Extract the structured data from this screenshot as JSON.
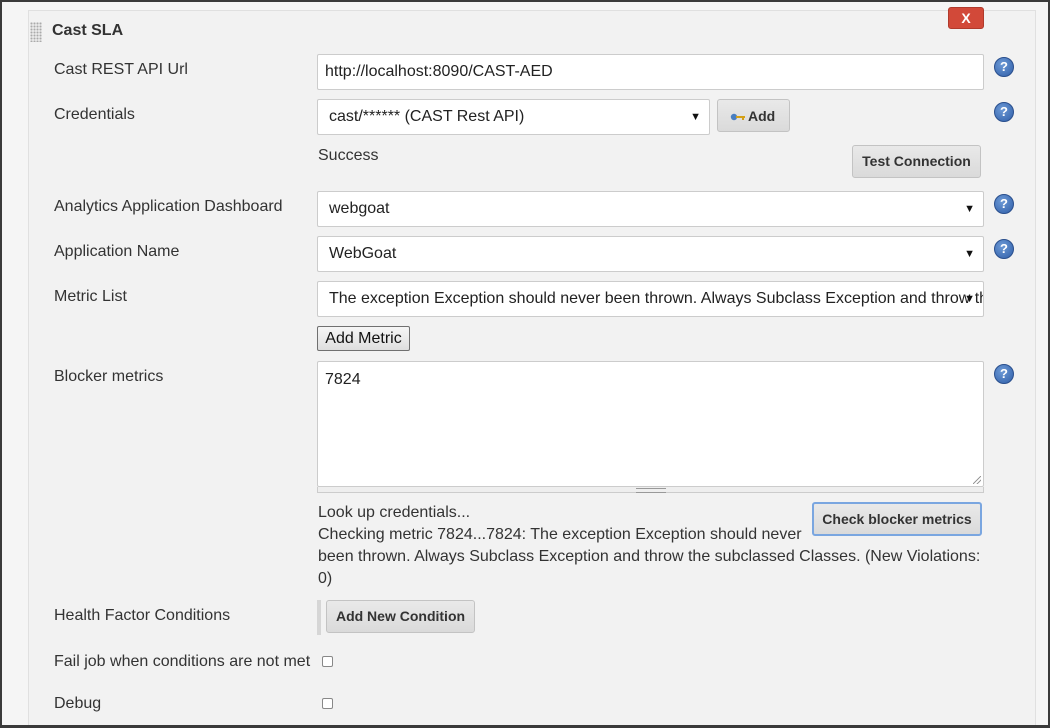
{
  "section": {
    "title": "Cast SLA",
    "delete_label": "X"
  },
  "help_glyph": "?",
  "fields": {
    "rest_api_url": {
      "label": "Cast REST API Url",
      "value": "http://localhost:8090/CAST-AED"
    },
    "credentials": {
      "label": "Credentials",
      "selected": "cast/****** (CAST Rest API)",
      "add_label": "Add",
      "status": "Success",
      "test_connection_label": "Test Connection"
    },
    "dashboard": {
      "label": "Analytics Application Dashboard",
      "selected": "webgoat"
    },
    "application_name": {
      "label": "Application Name",
      "selected": "WebGoat"
    },
    "metric_list": {
      "label": "Metric List",
      "selected": "The exception Exception should never been thrown. Always Subclass Exception and throw the subclassed Classes.",
      "add_metric_label": "Add Metric"
    },
    "blocker_metrics": {
      "label": "Blocker metrics",
      "value": "7824",
      "status_line1": "Look up credentials...",
      "status_line2": "Checking metric 7824...7824: The exception Exception should never",
      "status_line3": "been thrown. Always Subclass Exception and throw the subclassed Classes. (New Violations:",
      "status_line4": "0)",
      "check_label": "Check blocker metrics"
    },
    "health_factor": {
      "label": "Health Factor Conditions",
      "add_condition_label": "Add New Condition"
    },
    "fail_job": {
      "label": "Fail job when conditions are not met",
      "checked": false
    },
    "debug": {
      "label": "Debug",
      "checked": false
    }
  },
  "icons": {
    "dropdown": "▼",
    "help": "help-icon",
    "key": "key-icon",
    "grip": "drag-grip-icon"
  }
}
